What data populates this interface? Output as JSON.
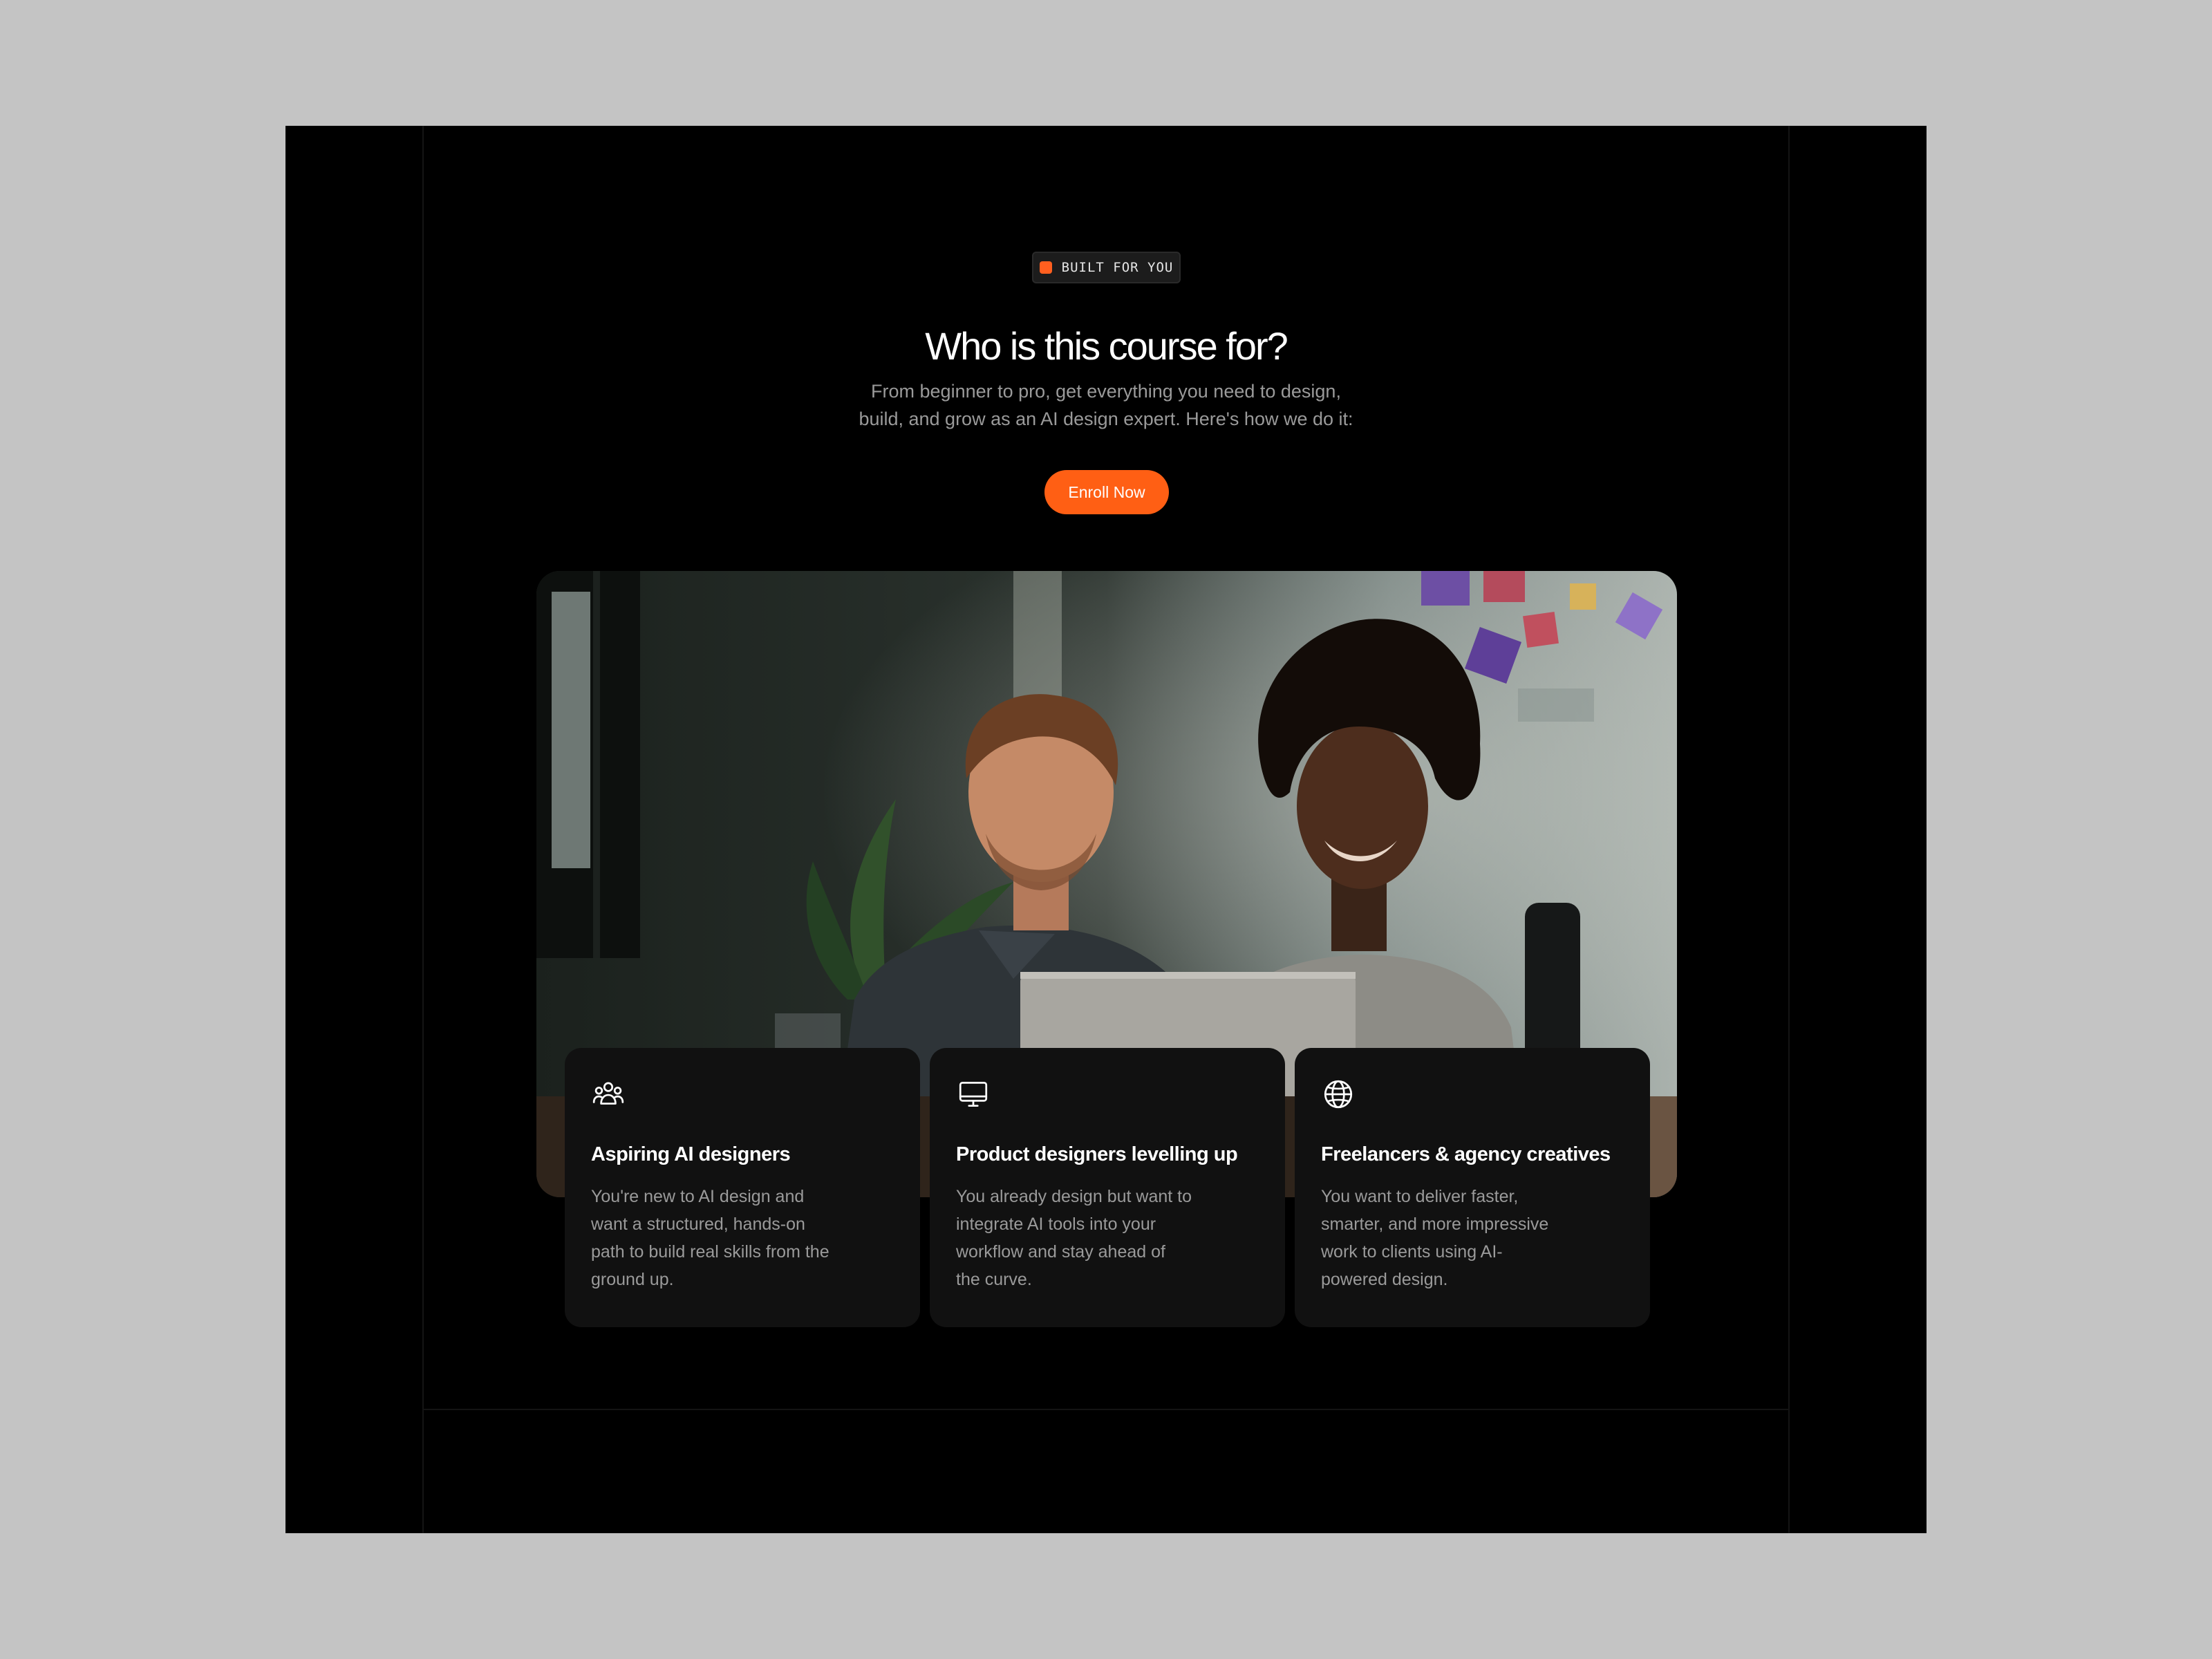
{
  "badge": {
    "label": "BUILT FOR YOU",
    "accent": "#ff5f1f"
  },
  "header": {
    "title": "Who is this course for?",
    "subtitle_lines": [
      "From beginner to pro, get everything you need to design,",
      "build, and grow as an AI design expert. Here's how we do it:"
    ]
  },
  "cta": {
    "label": "Enroll Now",
    "color": "#ff5f14"
  },
  "photo": {
    "semantic": "two-people-at-laptop-photo"
  },
  "cards": [
    {
      "icon": "users-icon",
      "title": "Aspiring AI designers",
      "lines": [
        "You're new to AI design and",
        "want a structured, hands-on",
        "path to build real skills from the",
        "ground up."
      ]
    },
    {
      "icon": "monitor-icon",
      "title": "Product designers levelling up",
      "lines": [
        "You already design but want to",
        "integrate AI tools into your",
        "workflow and stay ahead of",
        "the curve."
      ]
    },
    {
      "icon": "globe-icon",
      "title": "Freelancers & agency creatives",
      "lines": [
        "You want to deliver faster,",
        "smarter, and more impressive",
        "work to clients using AI-",
        "powered design."
      ]
    }
  ]
}
